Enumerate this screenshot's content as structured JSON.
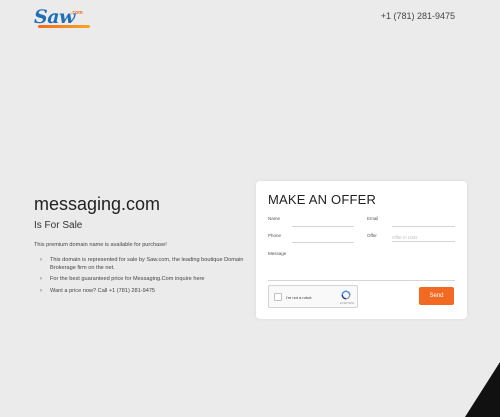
{
  "header": {
    "logo_text": "Saw",
    "logo_suffix": ".com",
    "phone": "+1 (781) 281-9475"
  },
  "main": {
    "domain": "messaging.com",
    "status": "Is For Sale",
    "intro": "This premium domain name is available for purchase!",
    "bullets": [
      "This domain is represented for sale by Saw.com, the leading boutique Domain Brokerage firm on the net.",
      "For the best guaranteed price for Messaging.Com inquire here",
      "Want a price now? Call +1 (781) 281-9475"
    ]
  },
  "offer_form": {
    "title": "MAKE AN OFFER",
    "name_label": "Name",
    "email_label": "Email",
    "phone_label": "Phone",
    "offer_label": "Offer",
    "offer_placeholder": "Offer in USD",
    "message_label": "Message",
    "captcha_label": "I'm not a robot",
    "captcha_brand": "reCAPTCHA",
    "send_label": "Send"
  },
  "colors": {
    "brand_blue": "#1e6fb8",
    "accent_orange": "#f26a21",
    "background": "#ebebeb"
  }
}
